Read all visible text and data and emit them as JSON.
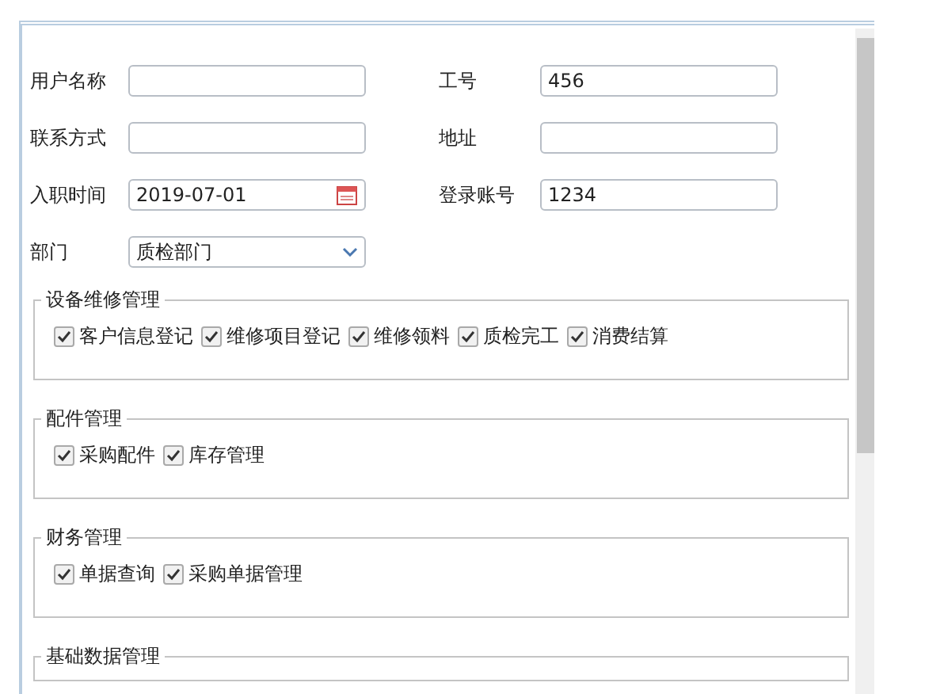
{
  "form": {
    "fields": [
      {
        "label": "用户名称",
        "kind": "text"
      },
      {
        "label": "工号",
        "kind": "text",
        "value": "456"
      },
      {
        "label": "联系方式",
        "kind": "text"
      },
      {
        "label": "地址",
        "kind": "text"
      },
      {
        "label": "入职时间",
        "kind": "date",
        "value": "2019-07-01"
      },
      {
        "label": "登录账号",
        "kind": "text",
        "value": "1234"
      },
      {
        "label": "部门",
        "kind": "select",
        "value": "质检部门"
      }
    ]
  },
  "groups": [
    {
      "title": "设备维修管理",
      "items": [
        {
          "label": "客户信息登记",
          "checked": true
        },
        {
          "label": "维修项目登记",
          "checked": true
        },
        {
          "label": "维修领料",
          "checked": true
        },
        {
          "label": "质检完工",
          "checked": true
        },
        {
          "label": "消费结算",
          "checked": true
        }
      ]
    },
    {
      "title": "配件管理",
      "items": [
        {
          "label": "采购配件",
          "checked": true
        },
        {
          "label": "库存管理",
          "checked": true
        }
      ]
    },
    {
      "title": "财务管理",
      "items": [
        {
          "label": "单据查询",
          "checked": true
        },
        {
          "label": "采购单据管理",
          "checked": true
        }
      ]
    },
    {
      "title": "基础数据管理"
    }
  ]
}
